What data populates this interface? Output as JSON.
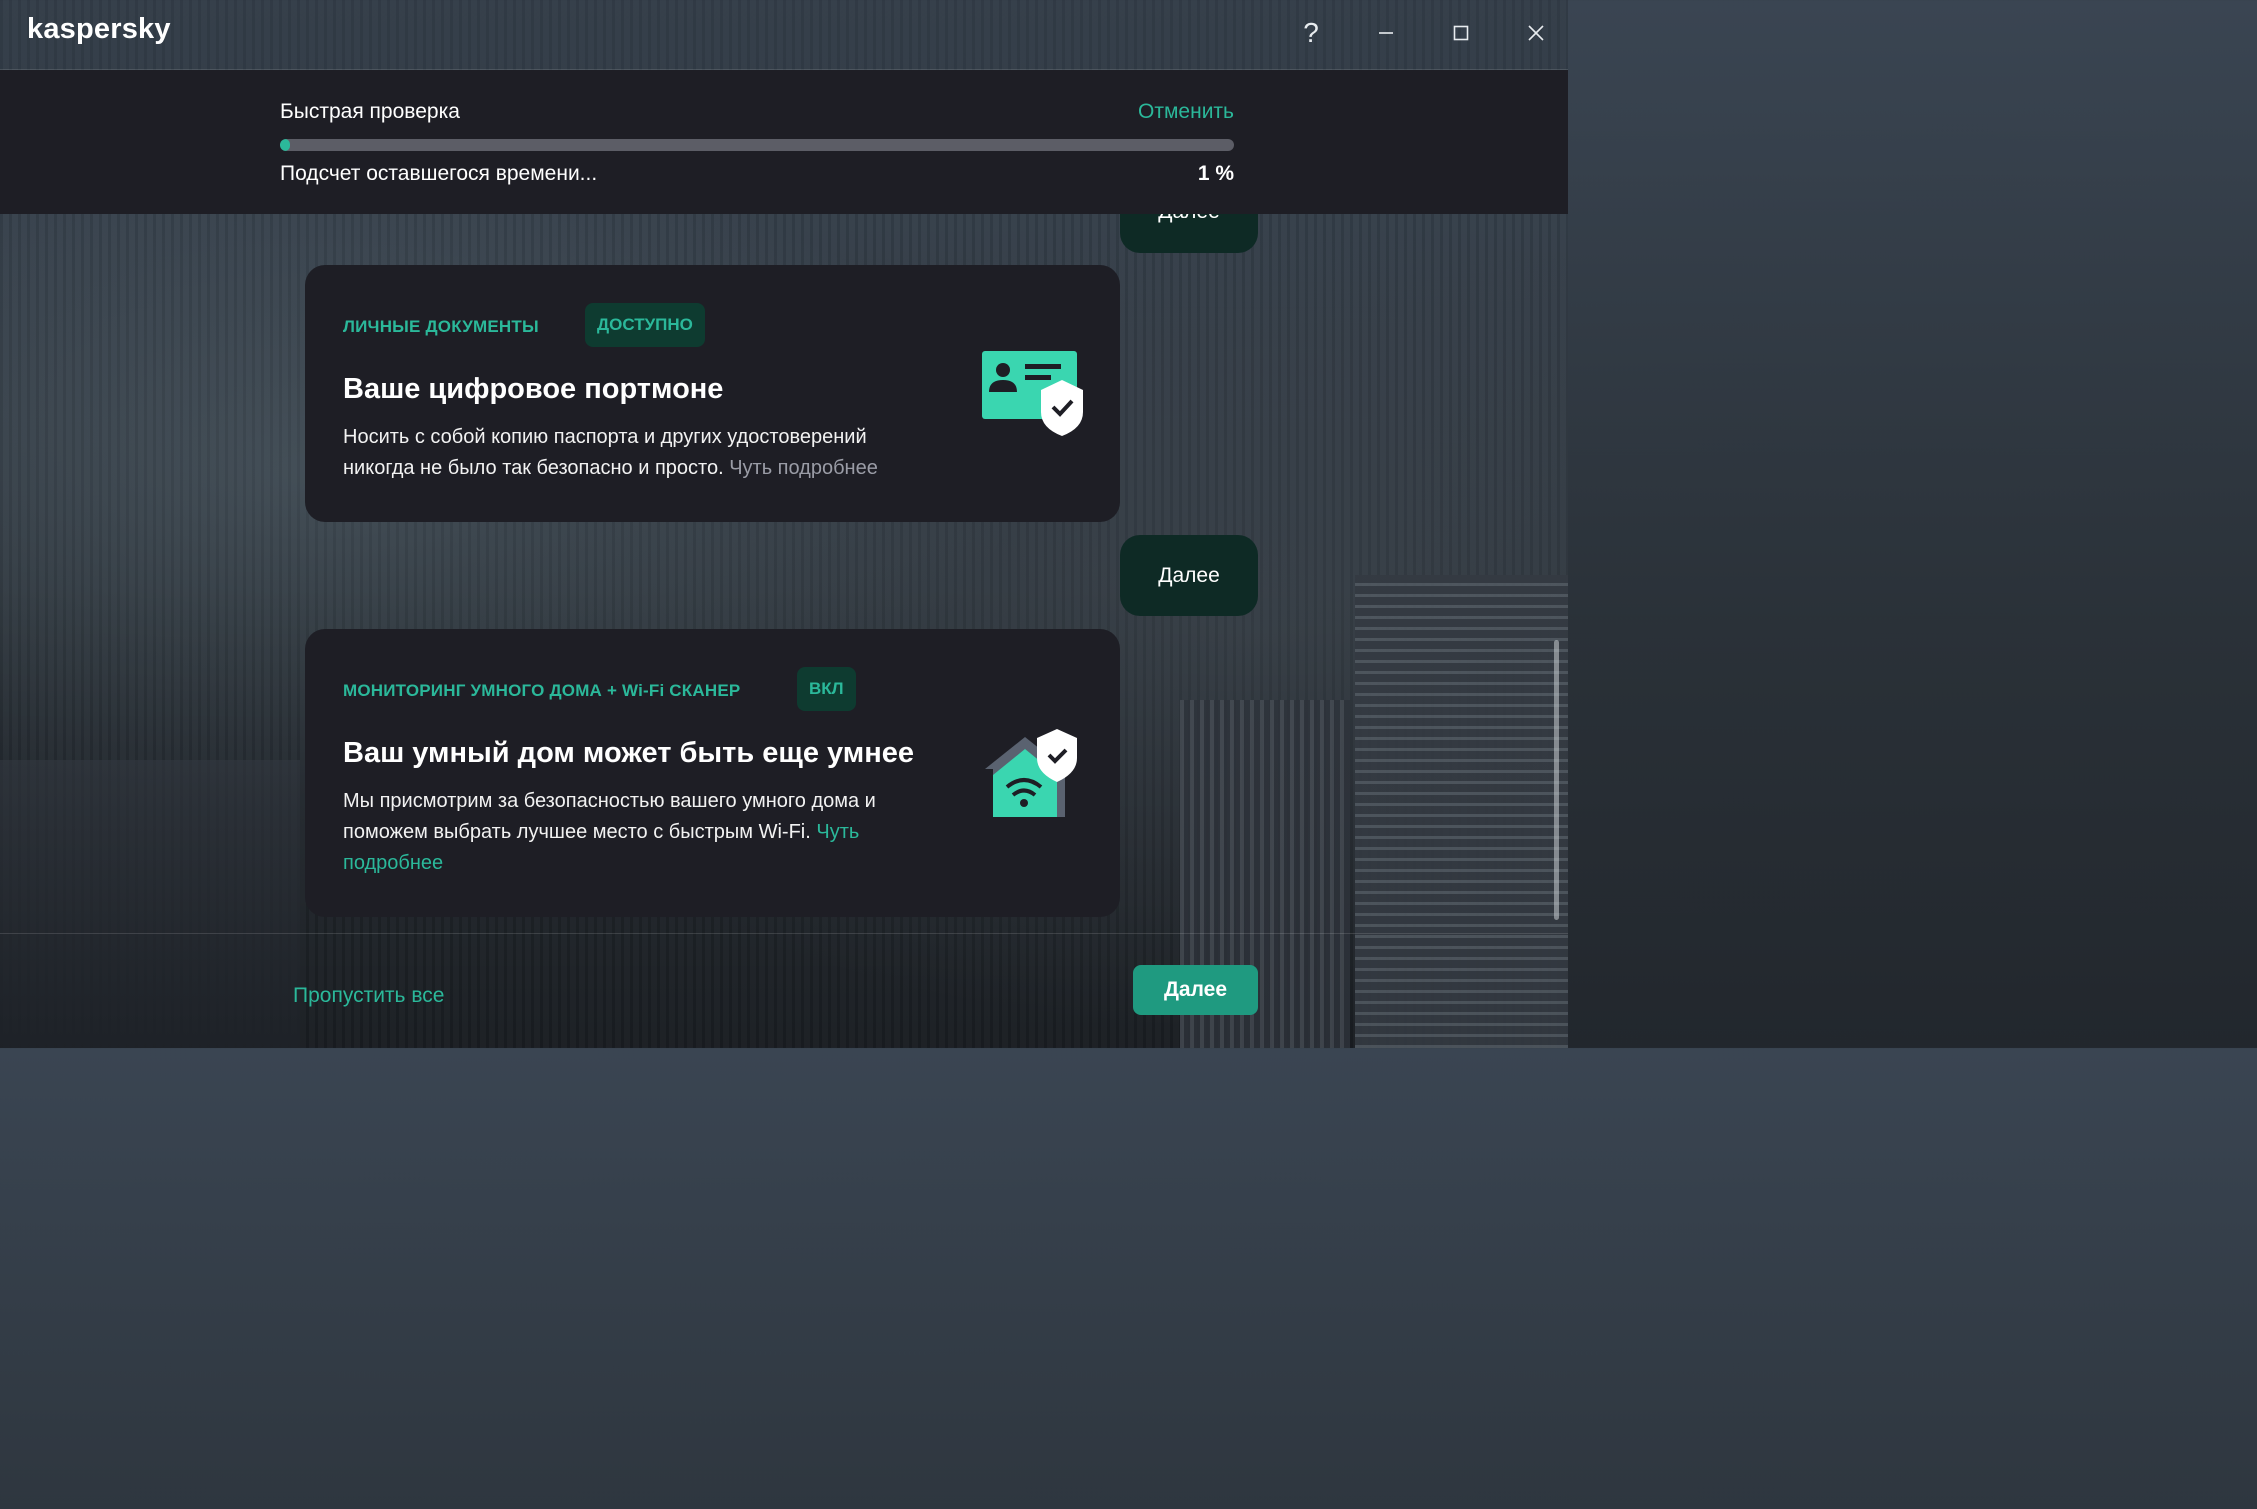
{
  "app": {
    "logo": "kaspersky"
  },
  "titlebar": {
    "help_label": "?",
    "minimize_icon": "minimize-icon",
    "maximize_icon": "maximize-icon",
    "close_icon": "close-icon"
  },
  "scan": {
    "title": "Быстрая проверка",
    "cancel_label": "Отменить",
    "status": "Подсчет оставшегося времени...",
    "percent_label": "1 %",
    "progress": 1,
    "accent": "#2bb89a"
  },
  "partial_next": {
    "label": "Далее"
  },
  "cards": [
    {
      "tag": "ЛИЧНЫЕ ДОКУМЕНТЫ",
      "badge": "ДОСТУПНО",
      "title": "Ваше цифровое портмоне",
      "desc": "Носить с собой копию паспорта и других удостоверений никогда не было так безопасно и просто.",
      "more": "Чуть подробнее",
      "icon": "id-card-shield-icon"
    },
    {
      "tag": "МОНИТОРИНГ УМНОГО ДОМА + Wi-Fi СКАНЕР",
      "badge": "ВКЛ",
      "title": "Ваш умный дом может быть еще умнее",
      "desc": "Мы присмотрим за безопасностью вашего умного дома и поможем выбрать лучшее место с быстрым Wi-Fi.",
      "more": "Чуть подробнее",
      "icon": "smart-home-wifi-shield-icon"
    }
  ],
  "card_next": {
    "label": "Далее"
  },
  "footer": {
    "skip_label": "Пропустить все",
    "next_label": "Далее"
  }
}
